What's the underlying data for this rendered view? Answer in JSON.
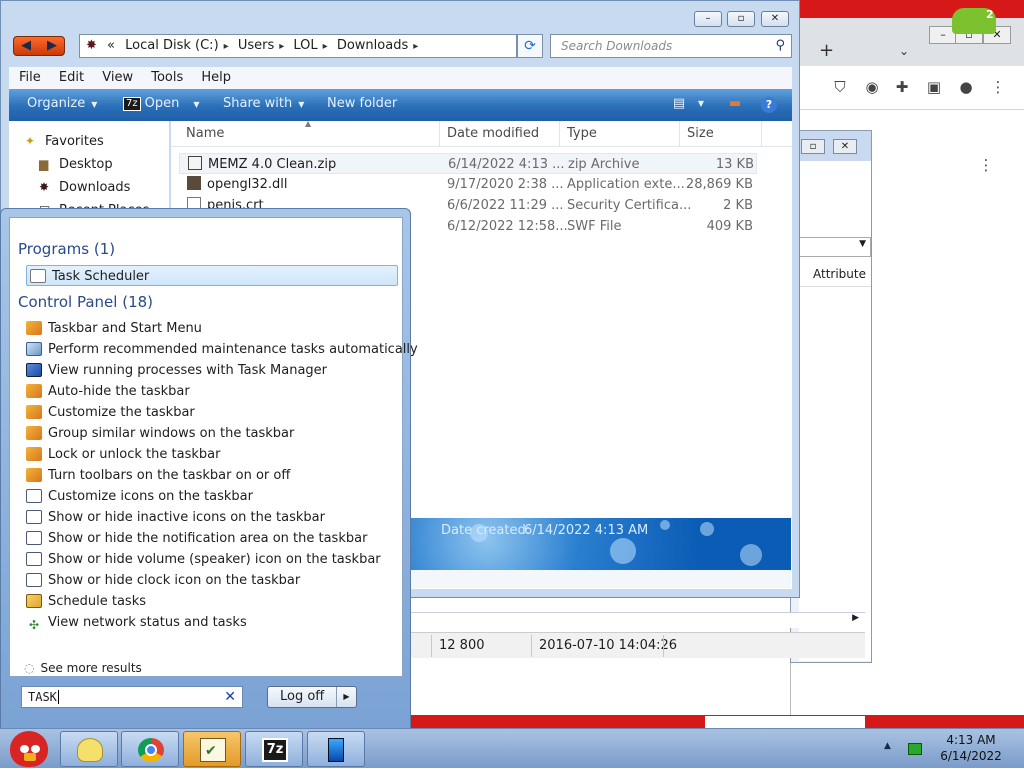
{
  "explorer": {
    "address": {
      "segments": [
        "Local Disk (C:)",
        "Users",
        "LOL",
        "Downloads"
      ],
      "prefix": "«"
    },
    "search_placeholder": "Search Downloads",
    "menu": [
      "File",
      "Edit",
      "View",
      "Tools",
      "Help"
    ],
    "commands": {
      "organize": "Organize",
      "open": "Open",
      "open_badge": "7z",
      "share": "Share with",
      "new_folder": "New folder"
    },
    "nav": [
      {
        "label": "Favorites",
        "icon": "star-icon"
      },
      {
        "label": "Desktop",
        "icon": "desktop-icon"
      },
      {
        "label": "Downloads",
        "icon": "downloads-icon"
      },
      {
        "label": "Recent Places",
        "icon": "recent-icon"
      }
    ],
    "columns": {
      "name": "Name",
      "date": "Date modified",
      "type": "Type",
      "size": "Size"
    },
    "files": [
      {
        "name": "MEMZ 4.0 Clean.zip",
        "date": "6/14/2022 4:13 ...",
        "type": "zip Archive",
        "size": "13 KB"
      },
      {
        "name": "opengl32.dll",
        "date": "9/17/2020 2:38 ...",
        "type": "Application exte...",
        "size": "28,869 KB"
      },
      {
        "name": "penis.crt",
        "date": "6/6/2022 11:29 ...",
        "type": "Security Certifica...",
        "size": "2 KB"
      },
      {
        "name": "",
        "date": "6/12/2022 12:58...",
        "type": "SWF File",
        "size": "409 KB"
      }
    ],
    "details": {
      "label": "Date created:",
      "value": "6/14/2022 4:13 AM"
    }
  },
  "dialog": {
    "attribute_col": "Attribute",
    "status": {
      "size": "12 800",
      "date": "2016-07-10 14:04:26"
    }
  },
  "startmenu": {
    "programs_heading": "Programs (1)",
    "programs": [
      {
        "label": "Task Scheduler",
        "icon": "clock-icon"
      }
    ],
    "cp_heading": "Control Panel (18)",
    "cp_items": [
      {
        "label": "Taskbar and Start Menu",
        "icon": "taskbar-icon"
      },
      {
        "label": "Perform recommended maintenance tasks automatically",
        "icon": "maintenance-icon"
      },
      {
        "label": "View running processes with Task Manager",
        "icon": "task-manager-icon"
      },
      {
        "label": "Auto-hide the taskbar",
        "icon": "taskbar-icon"
      },
      {
        "label": "Customize the taskbar",
        "icon": "taskbar-icon"
      },
      {
        "label": "Group similar windows on the taskbar",
        "icon": "taskbar-icon"
      },
      {
        "label": "Lock or unlock the taskbar",
        "icon": "taskbar-icon"
      },
      {
        "label": "Turn toolbars on the taskbar on or off",
        "icon": "taskbar-icon"
      },
      {
        "label": "Customize icons on the taskbar",
        "icon": "monitor-icon"
      },
      {
        "label": "Show or hide inactive icons on the taskbar",
        "icon": "monitor-icon"
      },
      {
        "label": "Show or hide the notification area on the taskbar",
        "icon": "monitor-icon"
      },
      {
        "label": "Show or hide volume (speaker) icon on the taskbar",
        "icon": "monitor-icon"
      },
      {
        "label": "Show or hide clock icon on the taskbar",
        "icon": "monitor-icon"
      },
      {
        "label": "Schedule tasks",
        "icon": "schedule-icon"
      },
      {
        "label": "View network status and tasks",
        "icon": "network-icon"
      }
    ],
    "see_more": "See more results",
    "search_value": "TASK",
    "logoff": "Log off"
  },
  "taskbar": {
    "apps": [
      {
        "name": "yellow-app",
        "active": false
      },
      {
        "name": "chrome",
        "active": false
      },
      {
        "name": "task-scheduler",
        "active": true
      },
      {
        "name": "7zip",
        "active": false,
        "badge": "7z"
      },
      {
        "name": "blue-app",
        "active": false
      }
    ],
    "time": "4:13 AM",
    "date": "6/14/2022"
  },
  "browser": {
    "frog_badge": "2"
  }
}
